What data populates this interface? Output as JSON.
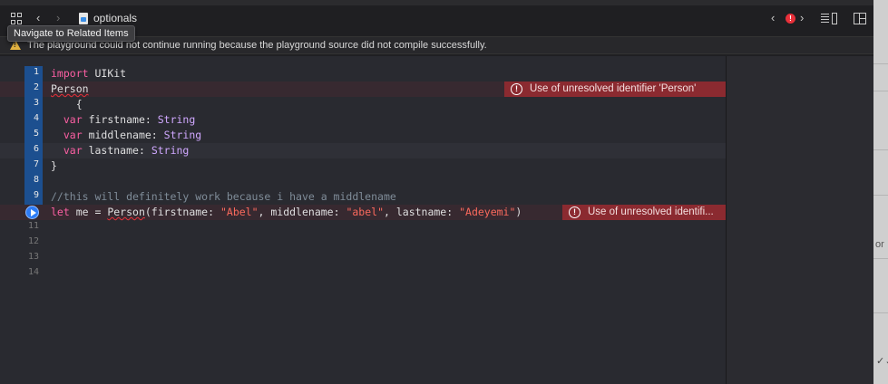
{
  "jumpbar": {
    "file_name": "optionals",
    "back_glyph": "‹",
    "forward_glyph": "›",
    "prev_issue_glyph": "‹",
    "next_issue_glyph": "›",
    "error_badge": "!",
    "icons": [
      "related-items-icon",
      "back-icon",
      "forward-icon",
      "playground-file-icon",
      "prev-issue-icon",
      "error-badge-icon",
      "next-issue-icon",
      "minimap-icon",
      "split-editor-icon"
    ]
  },
  "tooltip": {
    "text": "Navigate to Related Items"
  },
  "banner": {
    "message": "The playground could not continue running because the playground source did not compile successfully."
  },
  "colors": {
    "keyword": "#fc5fa3",
    "type": "#d0a8ff",
    "string": "#fc6a5d",
    "comment": "#7f8c98",
    "error_annotation": "#8b2a30",
    "gutter_active": "#1c4f8f",
    "run_button": "#2e7cf6",
    "warning": "#e3b341"
  },
  "editor": {
    "line_numbers": [
      "1",
      "2",
      "3",
      "4",
      "5",
      "6",
      "7",
      "8",
      "9",
      "10",
      "11",
      "12",
      "13",
      "14"
    ],
    "lines": [
      {
        "n": "1",
        "tokens": [
          {
            "t": "import",
            "c": "kw"
          },
          {
            "t": " UIKit",
            "c": "id"
          }
        ]
      },
      {
        "n": "2",
        "tokens": [
          {
            "t": "Person",
            "c": "id"
          }
        ]
      },
      {
        "n": "3",
        "tokens": [
          {
            "t": "    {",
            "c": "id"
          }
        ]
      },
      {
        "n": "4",
        "tokens": [
          {
            "t": "  "
          },
          {
            "t": "var",
            "c": "kw"
          },
          {
            "t": " firstname: ",
            "c": "id"
          },
          {
            "t": "String",
            "c": "ty"
          }
        ]
      },
      {
        "n": "5",
        "tokens": [
          {
            "t": "  "
          },
          {
            "t": "var",
            "c": "kw"
          },
          {
            "t": " middlename: ",
            "c": "id"
          },
          {
            "t": "String",
            "c": "ty"
          }
        ]
      },
      {
        "n": "6",
        "tokens": [
          {
            "t": "  "
          },
          {
            "t": "var",
            "c": "kw"
          },
          {
            "t": " lastname: ",
            "c": "id"
          },
          {
            "t": "String",
            "c": "ty"
          }
        ]
      },
      {
        "n": "7",
        "tokens": [
          {
            "t": "}",
            "c": "id"
          }
        ]
      },
      {
        "n": "8",
        "tokens": []
      },
      {
        "n": "9",
        "tokens": [
          {
            "t": "//this will definitely work because i have a middlename",
            "c": "cm"
          }
        ]
      },
      {
        "n": "10",
        "tokens": [
          {
            "t": "let",
            "c": "kw"
          },
          {
            "t": " me = ",
            "c": "id"
          },
          {
            "t": "Person",
            "c": "id"
          },
          {
            "t": "(firstname: ",
            "c": "id"
          },
          {
            "t": "\"Abel\"",
            "c": "str"
          },
          {
            "t": ", middlename: ",
            "c": "id"
          },
          {
            "t": "\"abel\"",
            "c": "str"
          },
          {
            "t": ", lastname: ",
            "c": "id"
          },
          {
            "t": "\"Adeyemi\"",
            "c": "str"
          },
          {
            "t": ")",
            "c": "id"
          }
        ]
      },
      {
        "n": "11",
        "tokens": []
      },
      {
        "n": "12",
        "tokens": []
      },
      {
        "n": "13",
        "tokens": []
      },
      {
        "n": "14",
        "tokens": []
      }
    ],
    "errors": {
      "line2": "Use of unresolved identifier 'Person'",
      "line10": "Use of unresolved identifi..."
    },
    "error_icon_glyph": "!"
  },
  "right_edge": {
    "partial_text": "or"
  }
}
